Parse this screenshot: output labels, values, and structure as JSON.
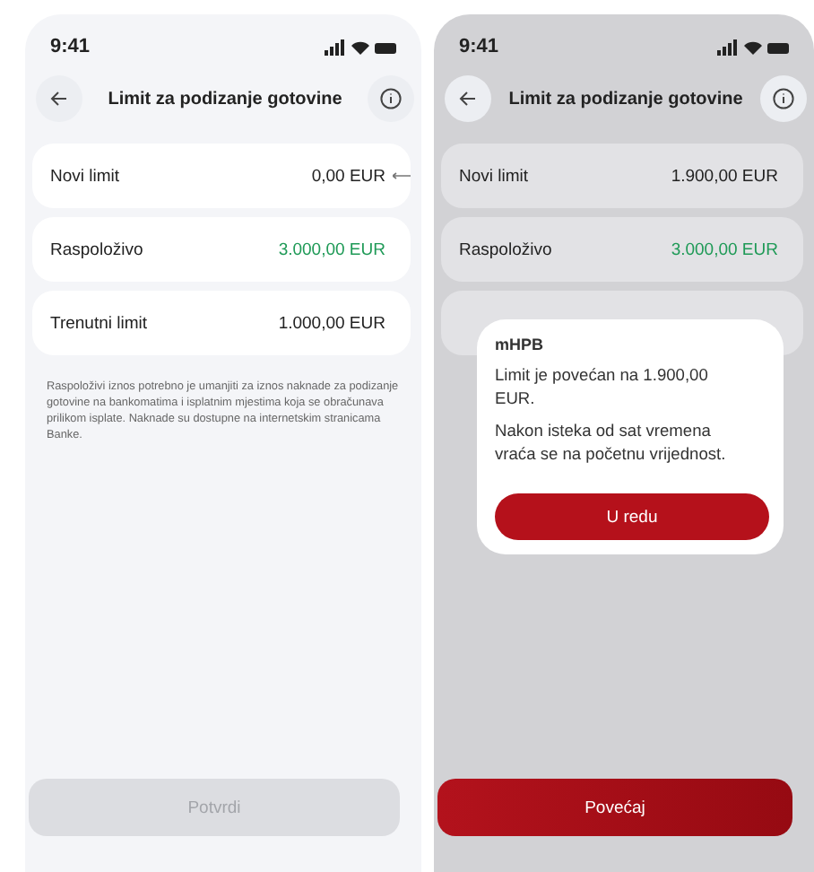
{
  "screens": [
    {
      "status_time": "9:41",
      "title": "Limit za podizanje gotovine",
      "rows": [
        {
          "label": "Novi limit",
          "value": "0,00 EUR",
          "pointer": true
        },
        {
          "label": "Raspoloživo",
          "value": "3.000,00 EUR",
          "color": "#1f9a57",
          "pointer": false
        },
        {
          "label": "Trenutni limit",
          "value": "1.000,00 EUR",
          "pointer": false
        }
      ],
      "note": "Raspoloživi iznos potrebno je umanjiti za iznos naknade za podizanje gotovine na bankomatima i isplatnim mjestima koja se obračunava prilikom isplate. Naknade su dostupne na internetskim stranicama Banke.",
      "button": {
        "label": "Potvrdi",
        "disabled": true
      }
    },
    {
      "status_time": "9:41",
      "title": "Limit za podizanje gotovine",
      "rows": [
        {
          "label": "Novi limit",
          "value": "1.900,00 EUR",
          "pointer": false
        },
        {
          "label": "Raspoloživo",
          "value": "3.000,00 EUR",
          "color": "#1f9a57",
          "pointer": false
        }
      ],
      "button": {
        "label": "Povećaj",
        "disabled": false
      },
      "dialog": {
        "title": "mHPB",
        "message": "Limit je povećan na 1.900,00 EUR.",
        "detail": "Nakon isteka od sat vremena vraća se na početnu vrijednost.",
        "button": "U redu"
      }
    }
  ]
}
